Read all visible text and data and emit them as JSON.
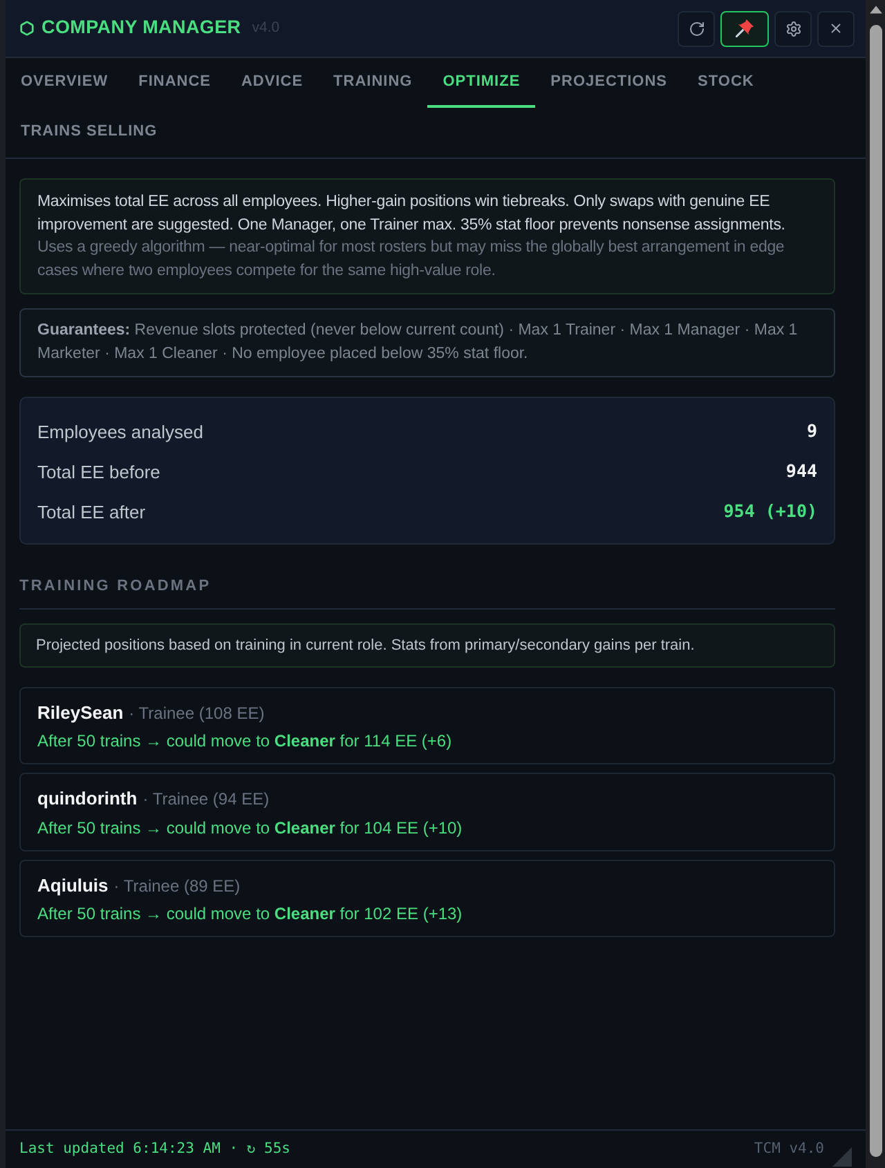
{
  "window": {
    "title": "COMPANY MANAGER",
    "version": "v4.0"
  },
  "toolbar_buttons": [
    {
      "kind": "refresh",
      "active": false
    },
    {
      "kind": "pin",
      "active": true
    },
    {
      "kind": "settings",
      "active": false
    },
    {
      "kind": "close",
      "active": false
    }
  ],
  "tabs": [
    {
      "label": "OVERVIEW",
      "selected": false
    },
    {
      "label": "FINANCE",
      "selected": false
    },
    {
      "label": "ADVICE",
      "selected": false
    },
    {
      "label": "TRAINING",
      "selected": false
    },
    {
      "label": "OPTIMIZE",
      "selected": true
    },
    {
      "label": "PROJECTIONS",
      "selected": false
    },
    {
      "label": "STOCK",
      "selected": false
    },
    {
      "label": "TRAINS SELLING",
      "selected": false
    }
  ],
  "info_note": {
    "main": "Maximises total EE across all employees. Higher-gain positions win tiebreaks. Only swaps with genuine EE improvement are suggested. One Manager, one Trainer max. 35% stat floor prevents nonsense assignments.",
    "caveat": "Uses a greedy algorithm — near-optimal for most rosters but may miss the globally best arrangement in edge cases where two employees compete for the same high-value role."
  },
  "guarantees": "**Guarantees:** Revenue slots protected (never below current count) · Max 1 Trainer · Max 1 Manager · Max 1 Marketer · Max 1 Cleaner · No employee placed below 35% stat floor.",
  "stats": [
    {
      "label": "Employees analysed",
      "value": "9",
      "kind": "plain"
    },
    {
      "label": "Total EE before",
      "value": "944",
      "kind": "plain"
    },
    {
      "label": "Total EE after",
      "value": "954 (+10)",
      "kind": "gain"
    }
  ],
  "roadmap": {
    "title": "TRAINING ROADMAP",
    "note": "Projected positions based on training in current role. Stats from primary/secondary gains per train.",
    "items": [
      {
        "name": "RileySean",
        "detail": "· Trainee (108 EE)",
        "projection": "After 50 trains → could move to **Cleaner** for 114 EE (+6)"
      },
      {
        "name": "quindorinth",
        "detail": "· Trainee (94 EE)",
        "projection": "After 50 trains → could move to **Cleaner** for 104 EE (+10)"
      },
      {
        "name": "Aqiuluis",
        "detail": "· Trainee (89 EE)",
        "projection": "After 50 trains → could move to **Cleaner** for 102 EE (+13)"
      }
    ]
  },
  "footer": {
    "status": "Last updated 6:14:23 AM · ↻ 55s",
    "version": "TCM v4.0"
  }
}
